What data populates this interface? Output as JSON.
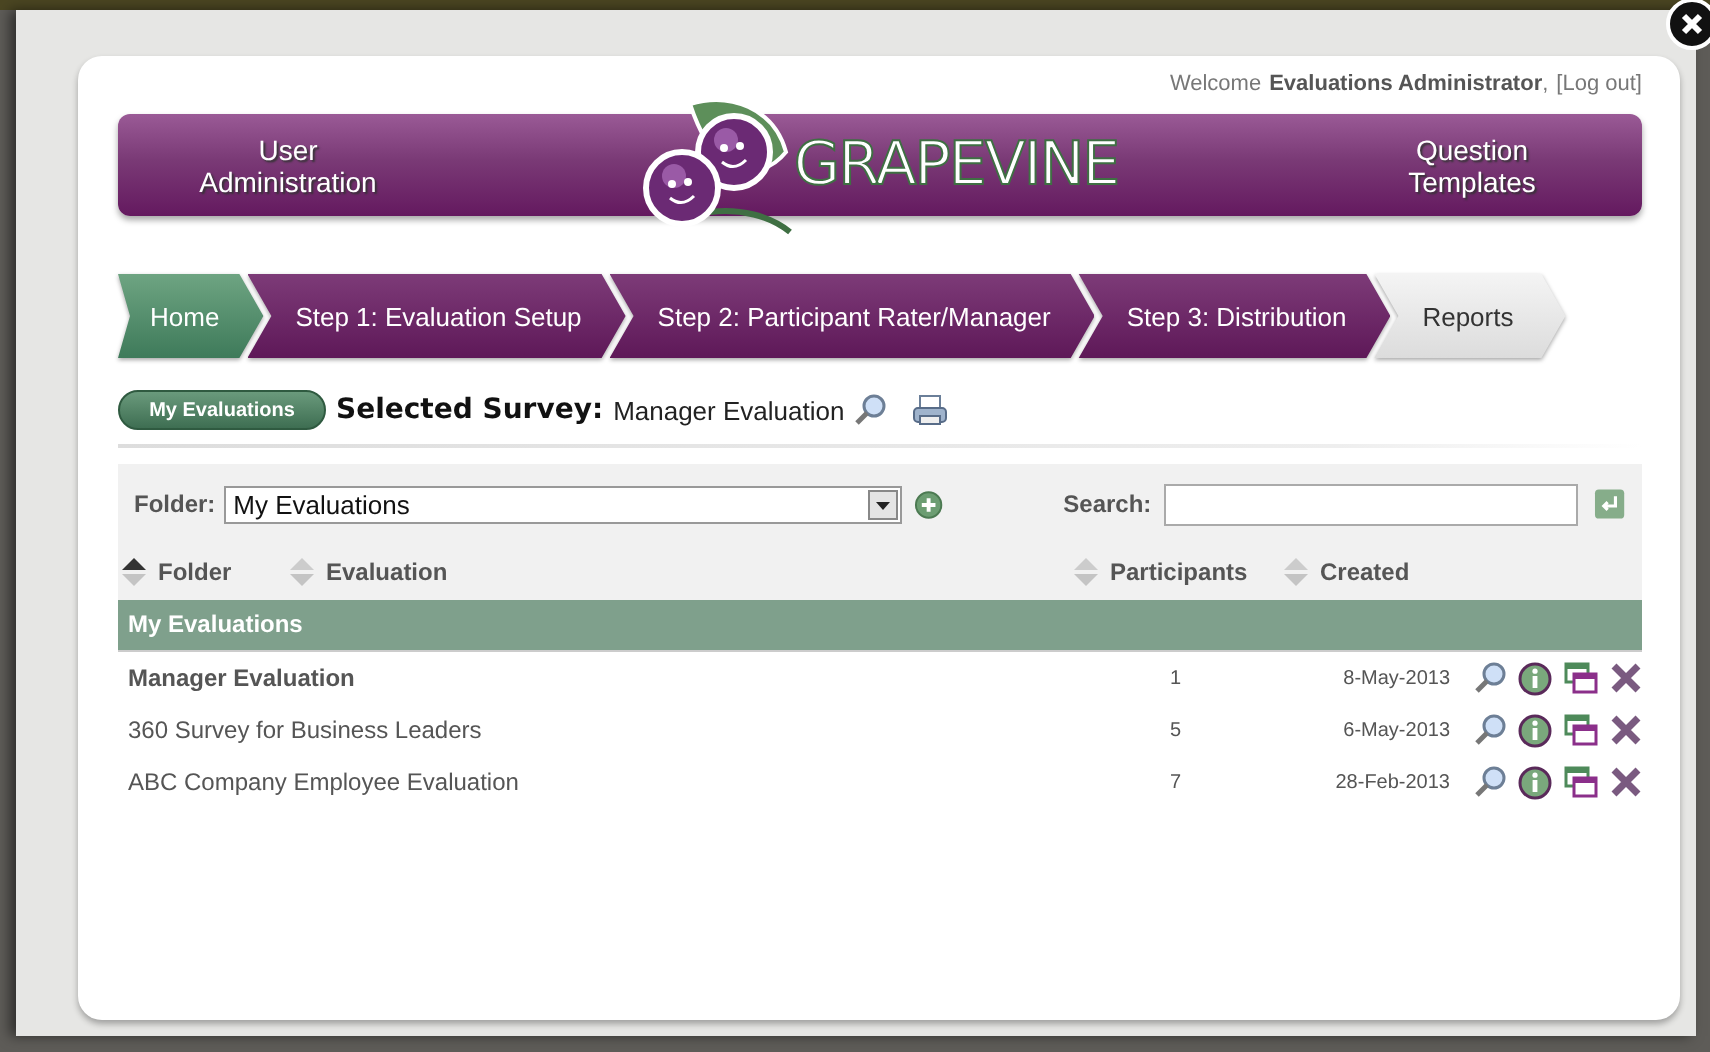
{
  "header": {
    "welcome": "Welcome",
    "user": "Evaluations Administrator",
    "separator": ",",
    "logout": "[Log out]"
  },
  "banner": {
    "left": [
      "User",
      "Administration"
    ],
    "logo": "GRAPEVINE",
    "right": [
      "Question",
      "Templates"
    ]
  },
  "steps": [
    {
      "label": "Home",
      "selected": true,
      "disabled": false
    },
    {
      "label": "Step 1: Evaluation Setup",
      "selected": false,
      "disabled": false
    },
    {
      "label": "Step 2: Participant Rater/Manager",
      "selected": false,
      "disabled": false
    },
    {
      "label": "Step 3: Distribution",
      "selected": false,
      "disabled": false
    },
    {
      "label": "Reports",
      "selected": false,
      "disabled": true
    }
  ],
  "survey_bar": {
    "button": "My Evaluations",
    "label": "Selected Survey:",
    "value": "Manager Evaluation"
  },
  "filters": {
    "folder_label": "Folder:",
    "folder_value": "My Evaluations",
    "search_label": "Search:"
  },
  "table": {
    "columns": [
      {
        "label": "Folder",
        "sorted": true
      },
      {
        "label": "Evaluation",
        "sorted": false
      },
      {
        "label": "Participants",
        "sorted": false
      },
      {
        "label": "Created",
        "sorted": false
      }
    ],
    "group": "My Evaluations",
    "rows": [
      {
        "name": "Manager Evaluation",
        "participants": "1",
        "created": "8-May-2013",
        "selected": true
      },
      {
        "name": "360 Survey for Business Leaders",
        "participants": "5",
        "created": "6-May-2013",
        "selected": false
      },
      {
        "name": "ABC Company Employee Evaluation",
        "participants": "7",
        "created": "28-Feb-2013",
        "selected": false
      }
    ]
  }
}
